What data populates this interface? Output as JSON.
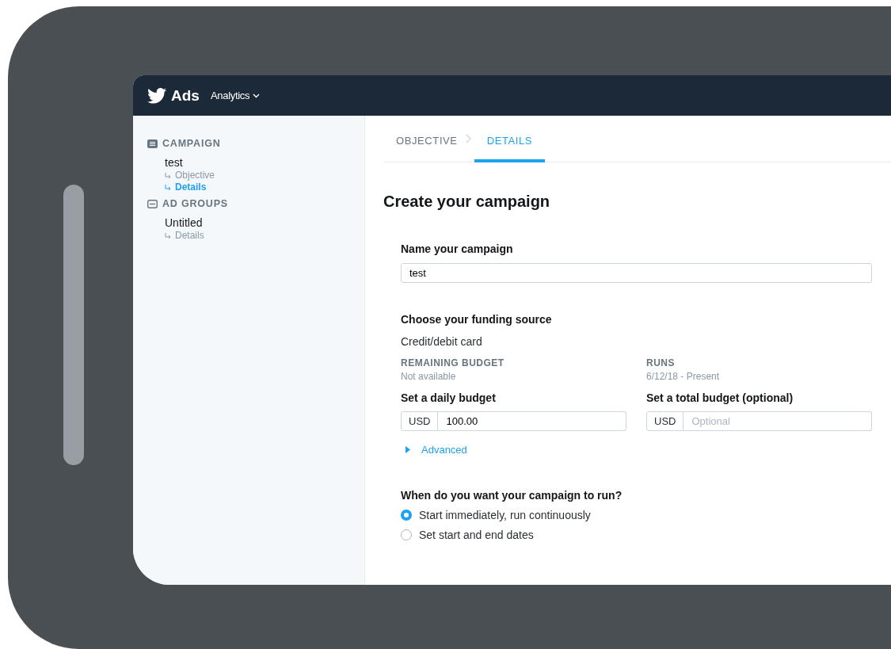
{
  "header": {
    "logo_text": "Ads",
    "menu": "Analytics"
  },
  "sidebar": {
    "sections": [
      {
        "title": "CAMPAIGN",
        "kind": "campaign",
        "items": [
          {
            "label": "test",
            "children": [
              {
                "label": "Objective",
                "selected": false
              },
              {
                "label": "Details",
                "selected": true
              }
            ]
          }
        ]
      },
      {
        "title": "AD GROUPS",
        "kind": "adgroups",
        "items": [
          {
            "label": "Untitled",
            "children": [
              {
                "label": "Details",
                "selected": false
              }
            ]
          }
        ]
      }
    ]
  },
  "steps": [
    {
      "label": "OBJECTIVE",
      "selected": false
    },
    {
      "label": "DETAILS",
      "selected": true
    }
  ],
  "page_title": "Create your campaign",
  "name_field": {
    "label": "Name your campaign",
    "value": "test"
  },
  "funding": {
    "label": "Choose your funding source",
    "source": "Credit/debit card",
    "stats": [
      {
        "label": "REMAINING BUDGET",
        "value": "Not available"
      },
      {
        "label": "RUNS",
        "value": "6/12/18 - Present"
      }
    ]
  },
  "budgets": [
    {
      "label": "Set a daily budget",
      "currency": "USD",
      "value": "100.00"
    },
    {
      "label": "Set a total budget (optional)",
      "currency": "USD",
      "placeholder": "Optional"
    }
  ],
  "advanced": {
    "label": "Advanced",
    "expanded": false
  },
  "schedule": {
    "label": "When do you want your campaign to run?",
    "options": [
      {
        "label": "Start immediately, run continuously",
        "selected": true
      },
      {
        "label": "Set start and end dates",
        "selected": false
      }
    ]
  }
}
